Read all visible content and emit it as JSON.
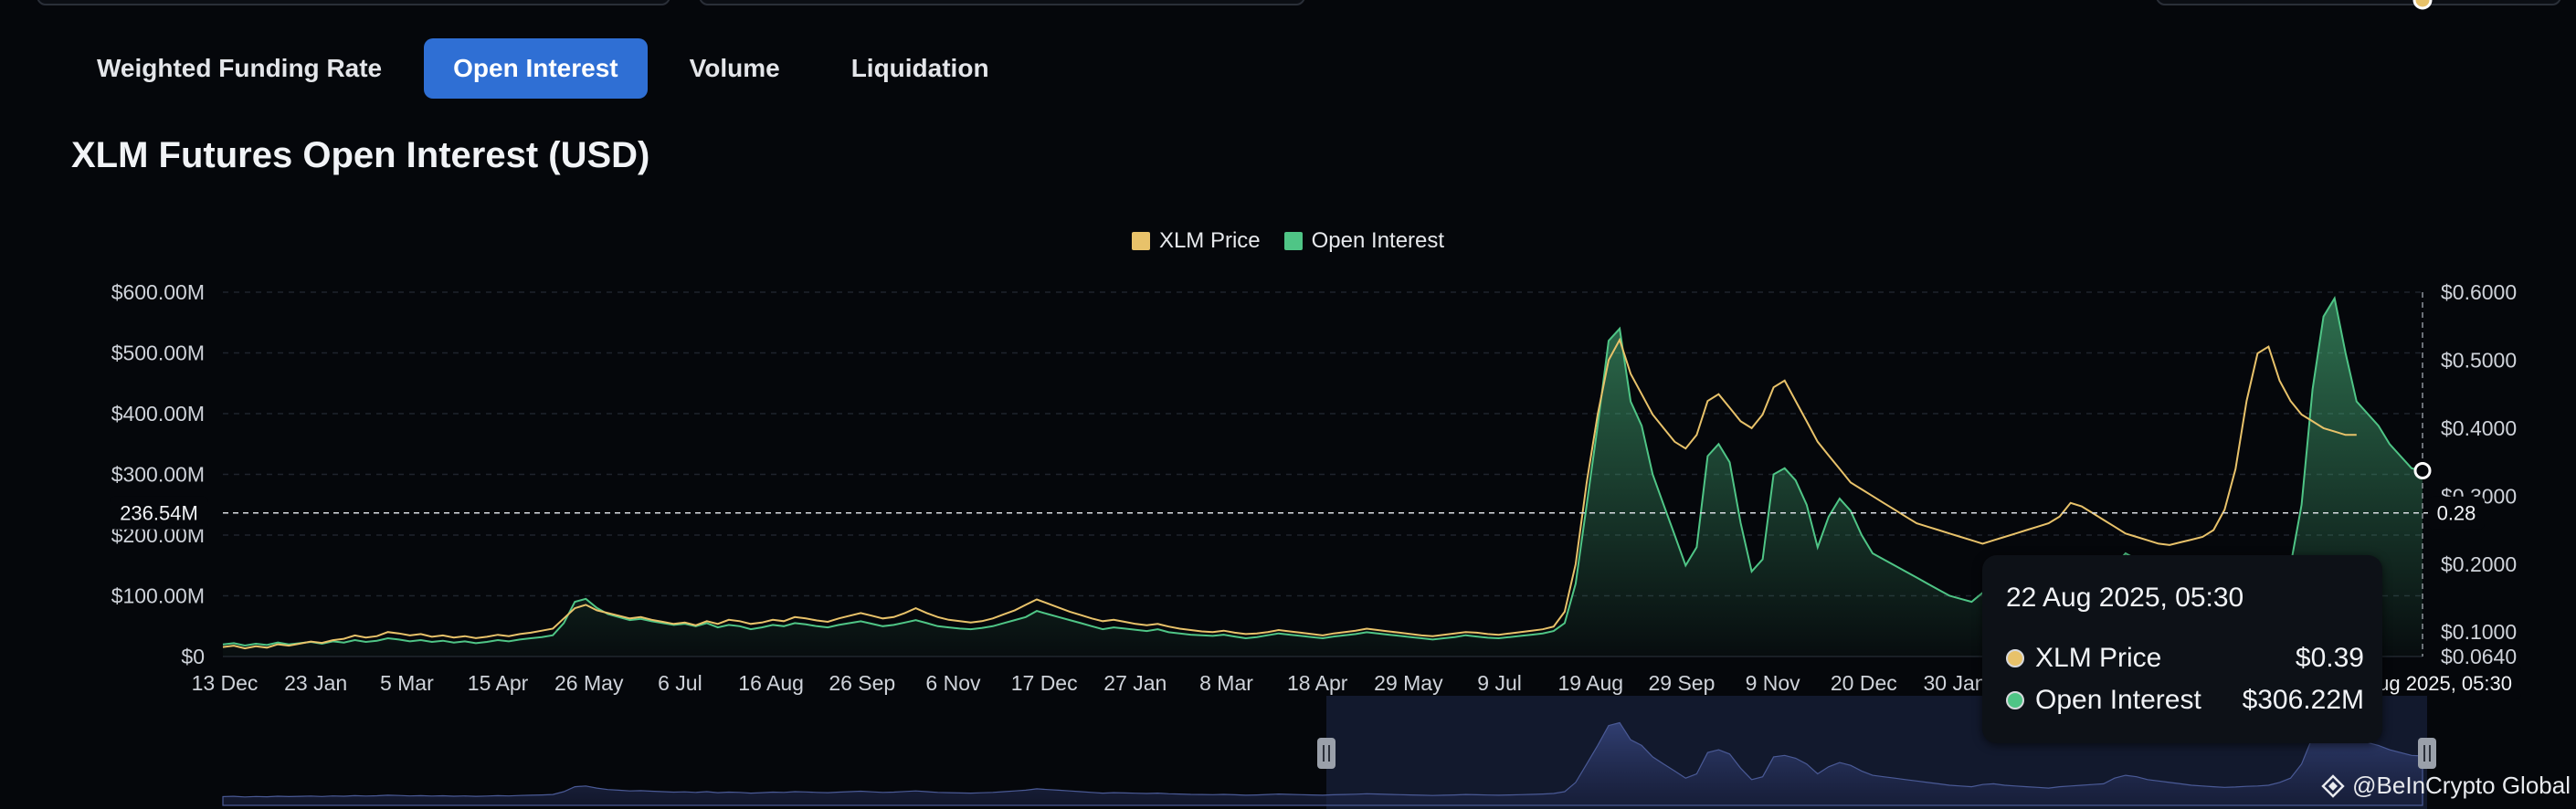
{
  "tabs": [
    {
      "label": "Weighted Funding Rate",
      "active": false
    },
    {
      "label": "Open Interest",
      "active": true
    },
    {
      "label": "Volume",
      "active": false
    },
    {
      "label": "Liquidation",
      "active": false
    }
  ],
  "title": "XLM Futures Open Interest (USD)",
  "legend": [
    {
      "label": "XLM Price",
      "color": "#e8c26a"
    },
    {
      "label": "Open Interest",
      "color": "#4fc586"
    }
  ],
  "crosshair": {
    "left_label": "236.54M",
    "right_label": "0.28",
    "x_label": "22 Aug 2025, 05:30"
  },
  "tooltip": {
    "date": "22 Aug 2025, 05:30",
    "rows": [
      {
        "label": "XLM Price",
        "value": "$0.39",
        "color": "#e8c26a"
      },
      {
        "label": "Open Interest",
        "value": "$306.22M",
        "color": "#4fc586"
      }
    ]
  },
  "watermark": "@BeInCrypto Global",
  "chart_data": {
    "type": "line",
    "title": "XLM Futures Open Interest (USD)",
    "x_ticks": [
      "13 Dec",
      "23 Jan",
      "5 Mar",
      "15 Apr",
      "26 May",
      "6 Jul",
      "16 Aug",
      "26 Sep",
      "6 Nov",
      "17 Dec",
      "27 Jan",
      "8 Mar",
      "18 Apr",
      "29 May",
      "9 Jul",
      "19 Aug",
      "29 Sep",
      "9 Nov",
      "20 Dec",
      "30 Jan",
      "22 Aug 2025, 05:30"
    ],
    "y_left_ticks": [
      "$600.00M",
      "$500.00M",
      "$400.00M",
      "$300.00M",
      "$200.00M",
      "$100.00M",
      "$0"
    ],
    "y_right_ticks": [
      "$0.6000",
      "$0.5000",
      "$0.4000",
      "$0.3000",
      "$0.2000",
      "$0.1000",
      "$0.0640"
    ],
    "ylim_left": [
      0,
      600
    ],
    "ylim_right": [
      0.064,
      0.6
    ],
    "grid": true,
    "legend_position": "top-center",
    "series": [
      {
        "name": "Open Interest",
        "axis": "left",
        "unit": "USD millions",
        "color": "#4fc586",
        "values": [
          20,
          22,
          18,
          21,
          19,
          23,
          20,
          22,
          24,
          21,
          25,
          23,
          27,
          24,
          26,
          30,
          28,
          25,
          27,
          24,
          26,
          23,
          25,
          22,
          24,
          27,
          25,
          28,
          30,
          32,
          35,
          55,
          90,
          95,
          80,
          70,
          65,
          60,
          62,
          58,
          55,
          52,
          54,
          50,
          55,
          48,
          52,
          50,
          45,
          48,
          52,
          50,
          55,
          53,
          50,
          48,
          52,
          55,
          58,
          54,
          50,
          52,
          56,
          60,
          55,
          50,
          48,
          46,
          45,
          47,
          50,
          55,
          60,
          65,
          75,
          70,
          65,
          60,
          55,
          50,
          45,
          48,
          46,
          44,
          42,
          45,
          40,
          38,
          36,
          35,
          34,
          36,
          33,
          30,
          32,
          35,
          38,
          36,
          34,
          32,
          30,
          33,
          35,
          37,
          40,
          38,
          36,
          34,
          32,
          30,
          28,
          30,
          32,
          35,
          33,
          31,
          30,
          32,
          34,
          36,
          38,
          42,
          55,
          120,
          250,
          380,
          520,
          540,
          420,
          380,
          300,
          250,
          200,
          150,
          180,
          330,
          350,
          320,
          220,
          140,
          160,
          300,
          310,
          290,
          250,
          180,
          230,
          260,
          240,
          200,
          170,
          160,
          150,
          140,
          130,
          120,
          110,
          100,
          95,
          90,
          105,
          110,
          100,
          95,
          90,
          85,
          80,
          90,
          95,
          100,
          105,
          110,
          150,
          170,
          160,
          140,
          130,
          120,
          110,
          100,
          95,
          90,
          85,
          88,
          92,
          95,
          100,
          120,
          150,
          250,
          440,
          560,
          590,
          500,
          420,
          400,
          380,
          350,
          330,
          310,
          306
        ]
      },
      {
        "name": "XLM Price",
        "axis": "right",
        "unit": "USD",
        "color": "#e8c26a",
        "values": [
          0.078,
          0.08,
          0.076,
          0.079,
          0.077,
          0.082,
          0.08,
          0.083,
          0.086,
          0.084,
          0.088,
          0.09,
          0.095,
          0.092,
          0.094,
          0.1,
          0.098,
          0.095,
          0.097,
          0.093,
          0.095,
          0.092,
          0.094,
          0.091,
          0.093,
          0.096,
          0.094,
          0.097,
          0.099,
          0.102,
          0.105,
          0.12,
          0.135,
          0.14,
          0.132,
          0.128,
          0.124,
          0.12,
          0.122,
          0.118,
          0.115,
          0.112,
          0.114,
          0.11,
          0.116,
          0.112,
          0.118,
          0.116,
          0.112,
          0.114,
          0.118,
          0.116,
          0.122,
          0.12,
          0.117,
          0.115,
          0.12,
          0.124,
          0.128,
          0.124,
          0.12,
          0.122,
          0.128,
          0.135,
          0.128,
          0.122,
          0.118,
          0.116,
          0.114,
          0.116,
          0.12,
          0.126,
          0.132,
          0.14,
          0.148,
          0.142,
          0.136,
          0.13,
          0.125,
          0.12,
          0.116,
          0.118,
          0.115,
          0.112,
          0.11,
          0.112,
          0.108,
          0.105,
          0.103,
          0.101,
          0.1,
          0.102,
          0.099,
          0.097,
          0.098,
          0.1,
          0.103,
          0.101,
          0.099,
          0.097,
          0.095,
          0.098,
          0.1,
          0.102,
          0.105,
          0.103,
          0.101,
          0.099,
          0.097,
          0.095,
          0.094,
          0.096,
          0.098,
          0.1,
          0.099,
          0.097,
          0.096,
          0.098,
          0.1,
          0.102,
          0.104,
          0.108,
          0.13,
          0.2,
          0.32,
          0.42,
          0.5,
          0.53,
          0.48,
          0.45,
          0.42,
          0.4,
          0.38,
          0.37,
          0.39,
          0.44,
          0.45,
          0.43,
          0.41,
          0.4,
          0.42,
          0.46,
          0.47,
          0.44,
          0.41,
          0.38,
          0.36,
          0.34,
          0.32,
          0.31,
          0.3,
          0.29,
          0.28,
          0.27,
          0.26,
          0.255,
          0.25,
          0.245,
          0.24,
          0.235,
          0.23,
          0.235,
          0.24,
          0.245,
          0.25,
          0.255,
          0.26,
          0.27,
          0.29,
          0.285,
          0.275,
          0.265,
          0.255,
          0.245,
          0.24,
          0.235,
          0.23,
          0.228,
          0.232,
          0.236,
          0.24,
          0.25,
          0.28,
          0.34,
          0.44,
          0.51,
          0.52,
          0.47,
          0.44,
          0.42,
          0.41,
          0.4,
          0.395,
          0.39,
          0.39
        ]
      }
    ]
  }
}
